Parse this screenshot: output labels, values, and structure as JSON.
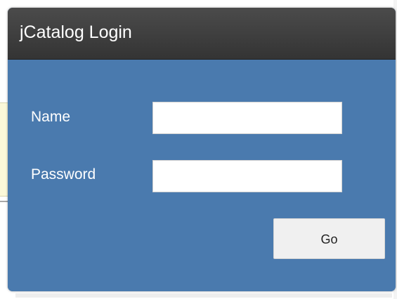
{
  "dialog": {
    "title": "jCatalog Login",
    "header_color": "#3d3d3d",
    "body_color": "#4a7aae"
  },
  "form": {
    "name_label": "Name",
    "name_value": "",
    "password_label": "Password",
    "password_value": "",
    "submit_label": "Go"
  }
}
